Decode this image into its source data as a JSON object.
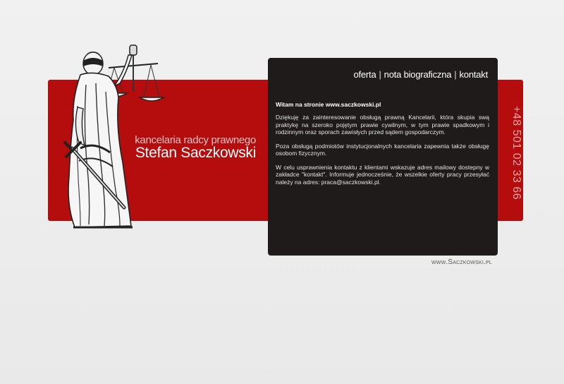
{
  "brand": {
    "tagline": "kancelaria radcy prawnego",
    "name": "Stefan Saczkowski",
    "statue_icon": "lady-justice-statue"
  },
  "nav": {
    "items": [
      "oferta",
      "nota biograficzna",
      "kontakt"
    ],
    "separator": "|"
  },
  "content": {
    "welcome": "Witam na stronie www.saczkowski.pl",
    "paragraphs": [
      "Dziękuję za zainteresowanie obsługą prawną Kancelarii, która skupia swą praktykę na szeroko pojętym prawie cywilnym, w tym prawie spadkowym i rodzinnym oraz sporach zawisłych przed sądem gospodarczym.",
      "Poza obsługą podmiotów instytucjonalnych kancelaria zapewnia także obsługę osobom fizycznym.",
      "W celu usprawnienia kontaktu z klientami wskazuje adres mailowy dostepny w zakładce \"kontakt\". Informuje jednocześnie, że wszelkie oferty pracy przesyłać należy na adres: praca@saczkowski.pl."
    ]
  },
  "phone": "+48 501 02 33 66",
  "footer_url": "www.Saczkowski.pl",
  "colors": {
    "band": "#b50d0d",
    "panel": "#1f1b1b",
    "background": "#ececec"
  }
}
